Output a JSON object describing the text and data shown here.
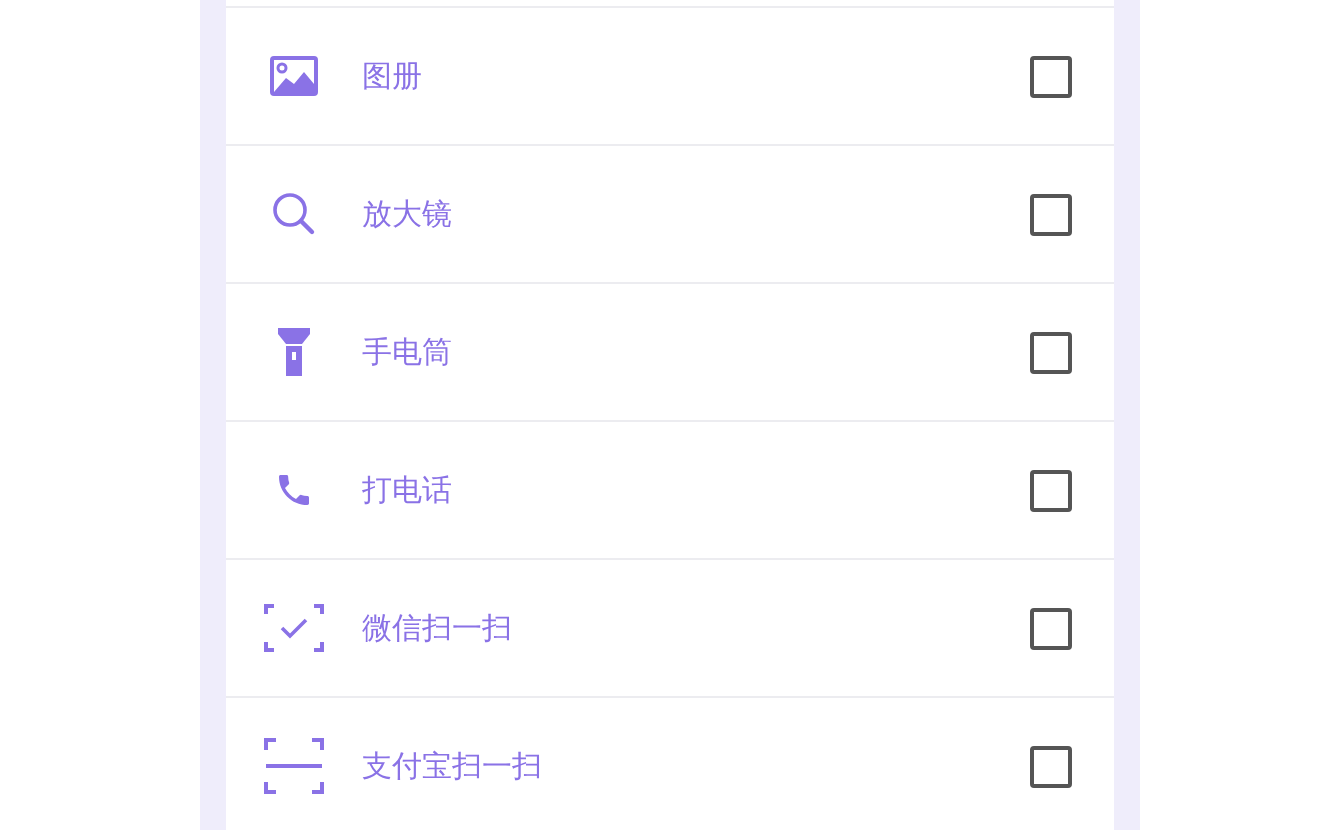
{
  "items": [
    {
      "kind": "gallery",
      "label": "图册",
      "checked": false
    },
    {
      "kind": "magnifier",
      "label": "放大镜",
      "checked": false
    },
    {
      "kind": "flashlight",
      "label": "手电筒",
      "checked": false
    },
    {
      "kind": "phone",
      "label": "打电话",
      "checked": false
    },
    {
      "kind": "scan-check",
      "label": "微信扫一扫",
      "checked": false
    },
    {
      "kind": "scan-line",
      "label": "支付宝扫一扫",
      "checked": false
    }
  ]
}
